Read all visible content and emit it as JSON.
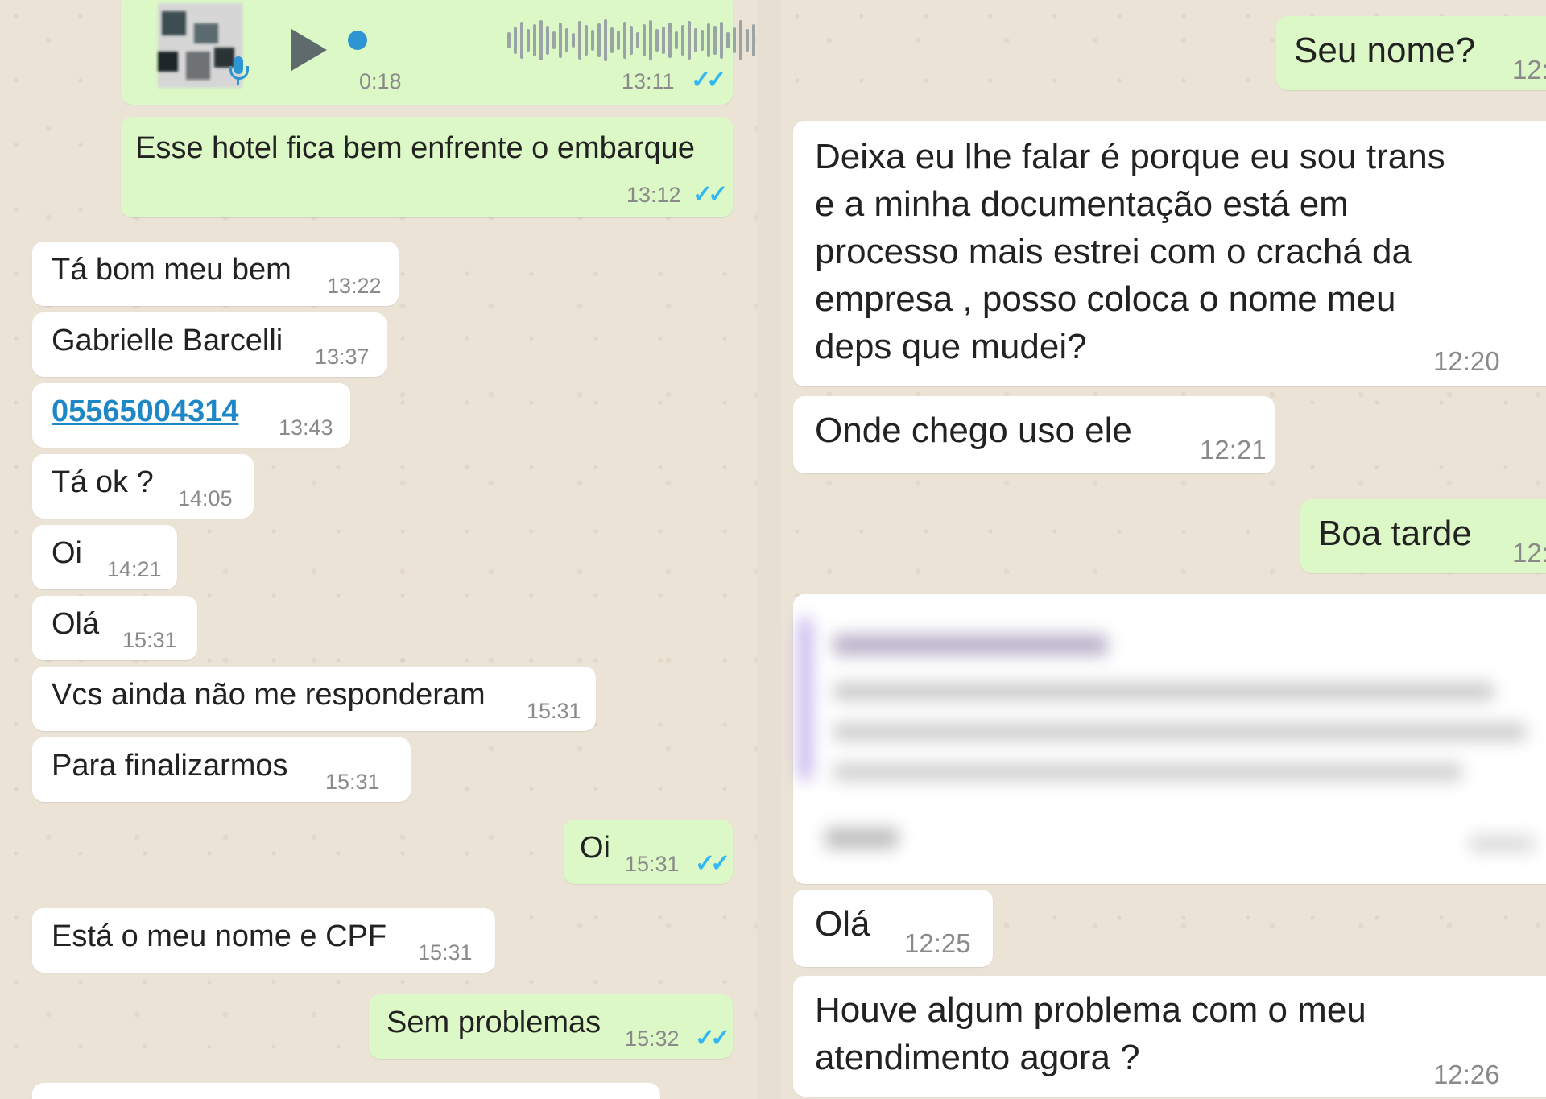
{
  "left_chat": {
    "voice_message": {
      "duration": "0:18",
      "time": "13:11"
    },
    "messages": [
      {
        "text": "Esse hotel fica bem enfrente o embarque",
        "time": "13:12"
      },
      {
        "text": "Tá bom meu bem",
        "time": "13:22"
      },
      {
        "text": "Gabrielle Barcelli",
        "time": "13:37"
      },
      {
        "text": "05565004314",
        "time": "13:43"
      },
      {
        "text": "Tá ok ?",
        "time": "14:05"
      },
      {
        "text": "Oi",
        "time": "14:21"
      },
      {
        "text": "Olá",
        "time": "15:31"
      },
      {
        "text": "Vcs ainda não me responderam",
        "time": "15:31"
      },
      {
        "text": "Para finalizarmos",
        "time": "15:31"
      },
      {
        "text": "Oi",
        "time": "15:31"
      },
      {
        "text": "Está o meu nome e CPF",
        "time": "15:31"
      },
      {
        "text": "Sem problemas",
        "time": "15:32"
      }
    ]
  },
  "right_chat": {
    "messages": [
      {
        "text": "Seu nome?",
        "time": "12:"
      },
      {
        "lines": [
          "Deixa eu lhe falar é porque eu sou trans",
          "e a minha documentação está em",
          "processo mais estrei com o crachá da",
          "empresa , posso coloca o nome meu",
          "deps que mudei?"
        ],
        "time": "12:20"
      },
      {
        "text": "Onde chego uso ele",
        "time": "12:21"
      },
      {
        "text": "Boa tarde",
        "time": "12:"
      },
      {
        "text": "Olá",
        "time": "12:25"
      },
      {
        "lines": [
          "Houve algum problema com o meu",
          "atendimento agora ?"
        ],
        "time": "12:26"
      }
    ]
  },
  "colors": {
    "incoming": "#ffffff",
    "outgoing": "#dcf8c6",
    "ticks": "#34b7f1",
    "link": "#1f87c6",
    "reply_bar": "#b7a3e6"
  },
  "icons": {
    "play": "play-icon",
    "mic": "microphone-icon",
    "read": "double-check-icon"
  }
}
